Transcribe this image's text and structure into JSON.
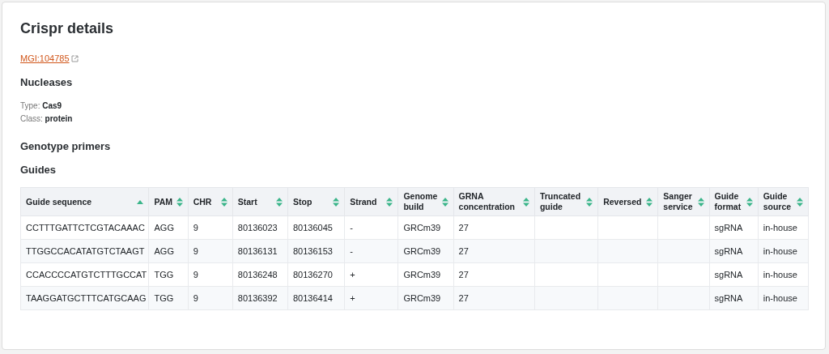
{
  "title": "Crispr details",
  "mgi_link": {
    "label": "MGI:104785"
  },
  "nucleases": {
    "heading": "Nucleases",
    "fields": [
      {
        "label": "Type:",
        "value": "Cas9"
      },
      {
        "label": "Class:",
        "value": "protein"
      }
    ]
  },
  "genotype_primers": {
    "heading": "Genotype primers"
  },
  "guides": {
    "heading": "Guides",
    "columns": [
      {
        "label": "Guide sequence",
        "sorted": true
      },
      {
        "label": "PAM",
        "sorted": false
      },
      {
        "label": "CHR",
        "sorted": false
      },
      {
        "label": "Start",
        "sorted": false
      },
      {
        "label": "Stop",
        "sorted": false
      },
      {
        "label": "Strand",
        "sorted": false
      },
      {
        "label": "Genome build",
        "sorted": false
      },
      {
        "label": "GRNA concentration",
        "sorted": false
      },
      {
        "label": "Truncated guide",
        "sorted": false
      },
      {
        "label": "Reversed",
        "sorted": false
      },
      {
        "label": "Sanger service",
        "sorted": false
      },
      {
        "label": "Guide format",
        "sorted": false
      },
      {
        "label": "Guide source",
        "sorted": false
      }
    ],
    "rows": [
      [
        "CCTTTGATTCTCGTACAAAC",
        "AGG",
        "9",
        "80136023",
        "80136045",
        "-",
        "GRCm39",
        "27",
        "",
        "",
        "",
        "sgRNA",
        "in-house"
      ],
      [
        "TTGGCCACATATGTCTAAGT",
        "AGG",
        "9",
        "80136131",
        "80136153",
        "-",
        "GRCm39",
        "27",
        "",
        "",
        "",
        "sgRNA",
        "in-house"
      ],
      [
        "CCACCCCATGTCTTTGCCAT",
        "TGG",
        "9",
        "80136248",
        "80136270",
        "+",
        "GRCm39",
        "27",
        "",
        "",
        "",
        "sgRNA",
        "in-house"
      ],
      [
        "TAAGGATGCTTTCATGCAAG",
        "TGG",
        "9",
        "80136392",
        "80136414",
        "+",
        "GRCm39",
        "27",
        "",
        "",
        "",
        "sgRNA",
        "in-house"
      ]
    ]
  }
}
